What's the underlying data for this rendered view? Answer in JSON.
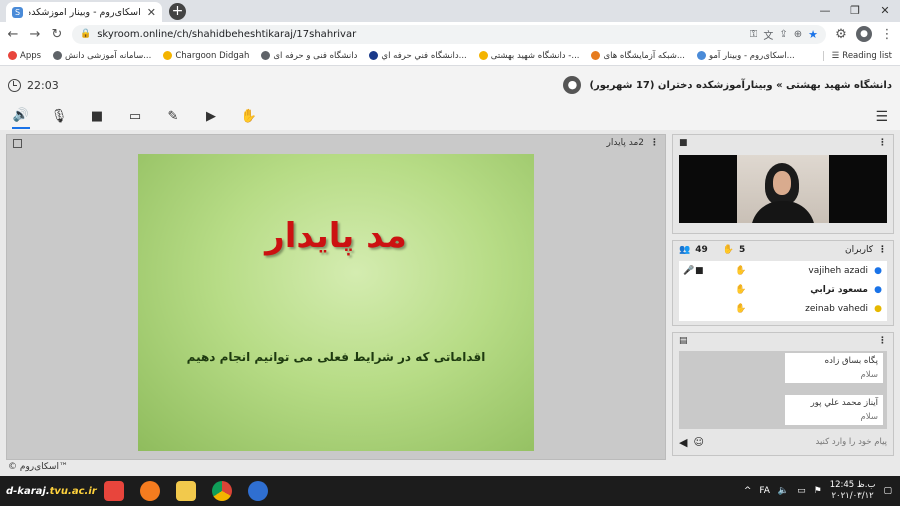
{
  "browser": {
    "tab_title": "اسکای‌روم - وبینار آموزشکده دخ",
    "tab_close": "✕",
    "new_tab": "+",
    "window_controls": [
      "—",
      "❐",
      "✕"
    ],
    "url": "skyroom.online/ch/shahidbeheshtikaraj/17shahrivar",
    "bookmarks": [
      {
        "label": "Apps",
        "color": "#e8453c"
      },
      {
        "label": "سامانه آموزشی دانش...",
        "color": "#5f6368"
      },
      {
        "label": "Chargoon Didgah",
        "color": "#f4b400"
      },
      {
        "label": "دانشگاه فنی و حرفه ای",
        "color": "#5f6368"
      },
      {
        "label": "دانشگاه فني حرفه اي...",
        "color": "#1a3a8a"
      },
      {
        "label": "دانشگاه شهید بهشتی -...",
        "color": "#f4b400"
      },
      {
        "label": "شبکه آزمایشگاه های...",
        "color": "#e67c1f"
      },
      {
        "label": "اسکای‌روم - وبینار آمو...",
        "color": "#4a8bd8"
      }
    ],
    "reading_list": "Reading list"
  },
  "app": {
    "clock": "22:03",
    "room_title": "دانشگاه شهید بهشتی » وبینارآموزشکده دختران (17 شهریور)",
    "main_panel_label": "2مد پایدار",
    "slide": {
      "title": "مد پایدار",
      "subtitle": "اقداماتی که در شرایط فعلی می توانیم انجام دهیم"
    },
    "brand": "© اسکای‌روم™",
    "users": {
      "title": "کاربران",
      "hands_count": "5",
      "users_count": "49",
      "list": [
        {
          "name": "vajiheh azadi",
          "has_mic": true,
          "has_cam": true,
          "hand": true
        },
        {
          "name": "مسعود ترابي",
          "has_mic": false,
          "has_cam": false,
          "hand": true
        },
        {
          "name": "zeinab vahedi",
          "has_mic": false,
          "has_cam": false,
          "hand": true
        }
      ]
    },
    "chat": {
      "messages": [
        {
          "who": "پگاه بساق زاده",
          "text": "سلام"
        },
        {
          "who": "آيناز محمد علي پور",
          "text": "سلام"
        }
      ],
      "placeholder": "پیام خود را وارد کنید"
    }
  },
  "taskbar": {
    "site_prefix": "d-karaj.",
    "site_suffix": "tvu.ac.ir",
    "lang": "FA",
    "time": "12:45 ب.ظ",
    "date": "۲۰۲۱/۰۳/۱۲"
  }
}
